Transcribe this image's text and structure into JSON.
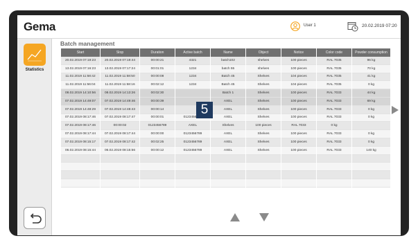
{
  "header": {
    "logo": "Gema",
    "user": "User 1",
    "datetime": "20.02.2019 07:20"
  },
  "sidebar": {
    "statistics_label": "Statistics"
  },
  "page": {
    "title": "Batch management",
    "marker": "5"
  },
  "table": {
    "columns": [
      "Start",
      "Stop",
      "Duration",
      "Active batch",
      "Name",
      "Object",
      "Notice",
      "Color code",
      "Powder consumption"
    ],
    "rows": [
      [
        "20.02.2019 07:19:23",
        "20.02.2019 07:19:44",
        "00:00:21",
        "4321",
        "batch102",
        "shelves",
        "100 pieces",
        "RAL 7035",
        "96 kg"
      ],
      [
        "13.02.2019 07:16:23",
        "13.02.2019 07:17:24",
        "00:01:01",
        "1234",
        "batch 55",
        "shelves",
        "100 pieces",
        "RAL 7035",
        "70 kg"
      ],
      [
        "11.02.2019 11:58:42",
        "11.02.2019 11:58:50",
        "00:00:08",
        "1234",
        "Batch 45",
        "Shelves",
        "104 pieces",
        "RAL 7035",
        "41 kg"
      ],
      [
        "11.02.2019 11:56:04",
        "11.02.2019 11:58:16",
        "00:02:12",
        "1234",
        "Batch 45",
        "Shelves",
        "104 pieces",
        "RAL 7035",
        "0 kg"
      ],
      [
        "08.02.2019 14:10:56",
        "08.02.2019 14:13:26",
        "00:02:30",
        "",
        "Batch 1",
        "Shelves",
        "100 pieces",
        "RAL 7033",
        "44 kg"
      ],
      [
        "07.02.2019 14:49:07",
        "07.02.2019 14:49:46",
        "00:00:39",
        "",
        "AXEL",
        "Shelves",
        "100 pieces",
        "RAL 7033",
        "69 kg"
      ],
      [
        "07.02.2019 14:48:29",
        "07.02.2019 14:48:43",
        "00:00:14",
        "",
        "AXEL",
        "Shelves",
        "100 pieces",
        "RAL 7033",
        "0 kg"
      ],
      [
        "07.02.2019 08:17:46",
        "07.02.2019 08:17:47",
        "00:00:01",
        "0123456789",
        "AXEL",
        "Shelves",
        "100 pieces",
        "RAL 7033",
        "0 kg"
      ],
      [
        "07.02.2019 08:17:46",
        "00:00:02",
        "0123456789",
        "AXEL",
        "Shelves",
        "100 pieces",
        "RAL 7033",
        "0 kg",
        ""
      ],
      [
        "07.02.2019 08:17:44",
        "07.02.2019 08:17:44",
        "00:00:00",
        "0123456789",
        "AXEL",
        "Shelves",
        "100 pieces",
        "RAL 7033",
        "0 kg"
      ],
      [
        "07.02.2019 08:15:17",
        "07.02.2019 08:17:42",
        "00:02:25",
        "0123456789",
        "AXEL",
        "Shelves",
        "100 pieces",
        "RAL 7033",
        "0 kg"
      ],
      [
        "06.02.2019 08:15:44",
        "06.02.2019 08:15:56",
        "00:00:12",
        "0123456789",
        "AXEL",
        "Shelves",
        "100 pieces",
        "RAL 7033",
        "140 kg"
      ],
      [
        "",
        "",
        "",
        "",
        "",
        "",
        "",
        "",
        ""
      ],
      [
        "",
        "",
        "",
        "",
        "",
        "",
        "",
        "",
        ""
      ],
      [
        "",
        "",
        "",
        "",
        "",
        "",
        "",
        "",
        ""
      ],
      [
        "",
        "",
        "",
        "",
        "",
        "",
        "",
        "",
        ""
      ]
    ]
  },
  "colors": {
    "accent": "#f5a623",
    "header_cell": "#707070",
    "marker": "#1f3a5f",
    "brand_dot": "#e2001a"
  },
  "icons": [
    "statistics-chart-icon",
    "user-icon",
    "clock-icon",
    "back-arrow-icon",
    "arrow-right-icon",
    "arrow-up-icon",
    "arrow-down-icon"
  ]
}
